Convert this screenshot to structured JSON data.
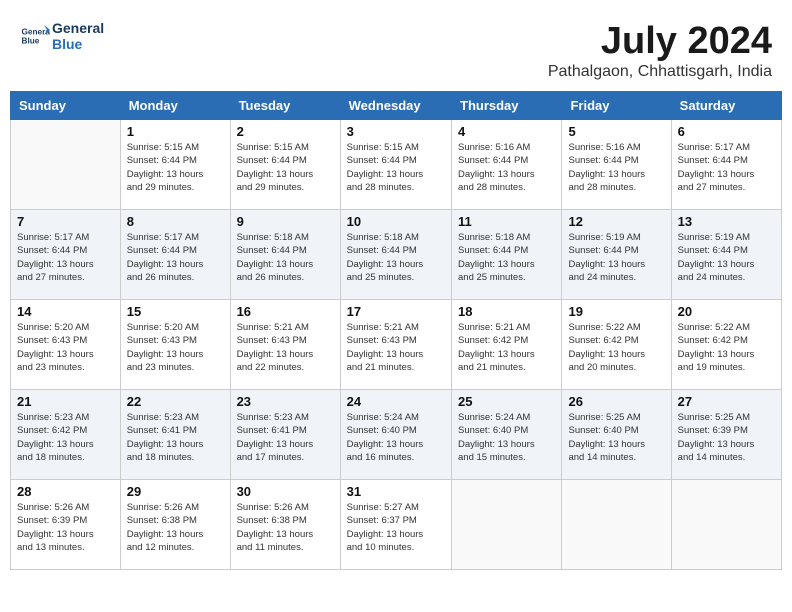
{
  "logo": {
    "line1": "General",
    "line2": "Blue"
  },
  "title": "July 2024",
  "location": "Pathalgaon, Chhattisgarh, India",
  "headers": [
    "Sunday",
    "Monday",
    "Tuesday",
    "Wednesday",
    "Thursday",
    "Friday",
    "Saturday"
  ],
  "weeks": [
    [
      {
        "day": "",
        "info": ""
      },
      {
        "day": "1",
        "info": "Sunrise: 5:15 AM\nSunset: 6:44 PM\nDaylight: 13 hours\nand 29 minutes."
      },
      {
        "day": "2",
        "info": "Sunrise: 5:15 AM\nSunset: 6:44 PM\nDaylight: 13 hours\nand 29 minutes."
      },
      {
        "day": "3",
        "info": "Sunrise: 5:15 AM\nSunset: 6:44 PM\nDaylight: 13 hours\nand 28 minutes."
      },
      {
        "day": "4",
        "info": "Sunrise: 5:16 AM\nSunset: 6:44 PM\nDaylight: 13 hours\nand 28 minutes."
      },
      {
        "day": "5",
        "info": "Sunrise: 5:16 AM\nSunset: 6:44 PM\nDaylight: 13 hours\nand 28 minutes."
      },
      {
        "day": "6",
        "info": "Sunrise: 5:17 AM\nSunset: 6:44 PM\nDaylight: 13 hours\nand 27 minutes."
      }
    ],
    [
      {
        "day": "7",
        "info": "Sunrise: 5:17 AM\nSunset: 6:44 PM\nDaylight: 13 hours\nand 27 minutes."
      },
      {
        "day": "8",
        "info": "Sunrise: 5:17 AM\nSunset: 6:44 PM\nDaylight: 13 hours\nand 26 minutes."
      },
      {
        "day": "9",
        "info": "Sunrise: 5:18 AM\nSunset: 6:44 PM\nDaylight: 13 hours\nand 26 minutes."
      },
      {
        "day": "10",
        "info": "Sunrise: 5:18 AM\nSunset: 6:44 PM\nDaylight: 13 hours\nand 25 minutes."
      },
      {
        "day": "11",
        "info": "Sunrise: 5:18 AM\nSunset: 6:44 PM\nDaylight: 13 hours\nand 25 minutes."
      },
      {
        "day": "12",
        "info": "Sunrise: 5:19 AM\nSunset: 6:44 PM\nDaylight: 13 hours\nand 24 minutes."
      },
      {
        "day": "13",
        "info": "Sunrise: 5:19 AM\nSunset: 6:44 PM\nDaylight: 13 hours\nand 24 minutes."
      }
    ],
    [
      {
        "day": "14",
        "info": "Sunrise: 5:20 AM\nSunset: 6:43 PM\nDaylight: 13 hours\nand 23 minutes."
      },
      {
        "day": "15",
        "info": "Sunrise: 5:20 AM\nSunset: 6:43 PM\nDaylight: 13 hours\nand 23 minutes."
      },
      {
        "day": "16",
        "info": "Sunrise: 5:21 AM\nSunset: 6:43 PM\nDaylight: 13 hours\nand 22 minutes."
      },
      {
        "day": "17",
        "info": "Sunrise: 5:21 AM\nSunset: 6:43 PM\nDaylight: 13 hours\nand 21 minutes."
      },
      {
        "day": "18",
        "info": "Sunrise: 5:21 AM\nSunset: 6:42 PM\nDaylight: 13 hours\nand 21 minutes."
      },
      {
        "day": "19",
        "info": "Sunrise: 5:22 AM\nSunset: 6:42 PM\nDaylight: 13 hours\nand 20 minutes."
      },
      {
        "day": "20",
        "info": "Sunrise: 5:22 AM\nSunset: 6:42 PM\nDaylight: 13 hours\nand 19 minutes."
      }
    ],
    [
      {
        "day": "21",
        "info": "Sunrise: 5:23 AM\nSunset: 6:42 PM\nDaylight: 13 hours\nand 18 minutes."
      },
      {
        "day": "22",
        "info": "Sunrise: 5:23 AM\nSunset: 6:41 PM\nDaylight: 13 hours\nand 18 minutes."
      },
      {
        "day": "23",
        "info": "Sunrise: 5:23 AM\nSunset: 6:41 PM\nDaylight: 13 hours\nand 17 minutes."
      },
      {
        "day": "24",
        "info": "Sunrise: 5:24 AM\nSunset: 6:40 PM\nDaylight: 13 hours\nand 16 minutes."
      },
      {
        "day": "25",
        "info": "Sunrise: 5:24 AM\nSunset: 6:40 PM\nDaylight: 13 hours\nand 15 minutes."
      },
      {
        "day": "26",
        "info": "Sunrise: 5:25 AM\nSunset: 6:40 PM\nDaylight: 13 hours\nand 14 minutes."
      },
      {
        "day": "27",
        "info": "Sunrise: 5:25 AM\nSunset: 6:39 PM\nDaylight: 13 hours\nand 14 minutes."
      }
    ],
    [
      {
        "day": "28",
        "info": "Sunrise: 5:26 AM\nSunset: 6:39 PM\nDaylight: 13 hours\nand 13 minutes."
      },
      {
        "day": "29",
        "info": "Sunrise: 5:26 AM\nSunset: 6:38 PM\nDaylight: 13 hours\nand 12 minutes."
      },
      {
        "day": "30",
        "info": "Sunrise: 5:26 AM\nSunset: 6:38 PM\nDaylight: 13 hours\nand 11 minutes."
      },
      {
        "day": "31",
        "info": "Sunrise: 5:27 AM\nSunset: 6:37 PM\nDaylight: 13 hours\nand 10 minutes."
      },
      {
        "day": "",
        "info": ""
      },
      {
        "day": "",
        "info": ""
      },
      {
        "day": "",
        "info": ""
      }
    ]
  ]
}
